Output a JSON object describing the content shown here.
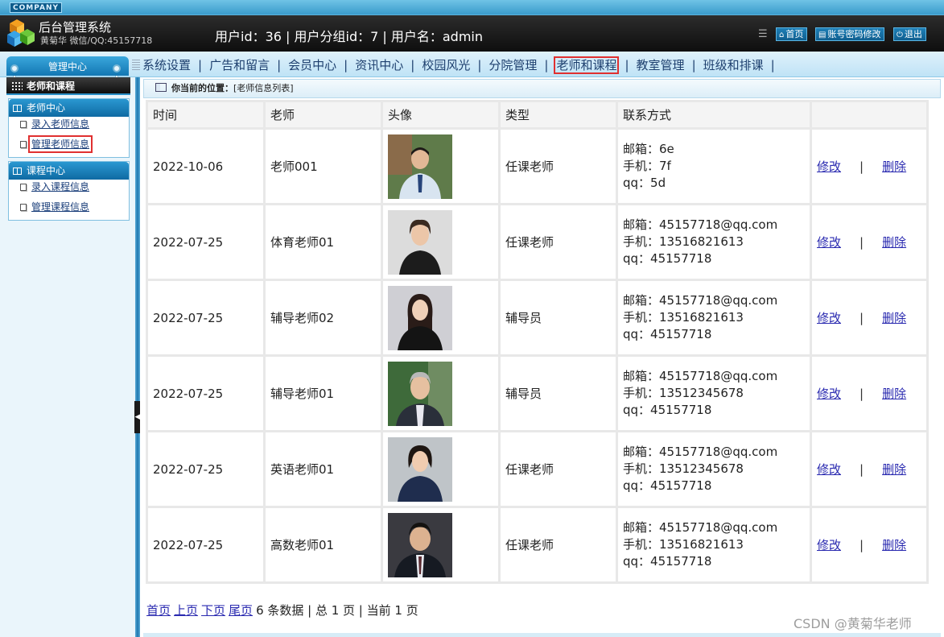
{
  "header": {
    "company": "COMPANY",
    "title": "后台管理系统",
    "author": "黄菊华 微信/QQ:45157718",
    "user_info": "用户id：36 | 用户分组id：7 | 用户名：admin",
    "buttons": {
      "home": "首页",
      "password": "账号密码修改",
      "logout": "退出"
    }
  },
  "nav": {
    "management_center": "管理中心",
    "items": [
      "系统设置",
      "广告和留言",
      "会员中心",
      "资讯中心",
      "校园风光",
      "分院管理",
      "老师和课程",
      "教室管理",
      "班级和排课"
    ],
    "active": "老师和课程",
    "separator": "|"
  },
  "sidebar": {
    "heading": "老师和课程",
    "groups": [
      {
        "title": "老师中心",
        "items": [
          "录入老师信息",
          "管理老师信息"
        ]
      },
      {
        "title": "课程中心",
        "items": [
          "录入课程信息",
          "管理课程信息"
        ]
      }
    ],
    "active_item": "管理老师信息"
  },
  "breadcrumb": {
    "label": "你当前的位置：",
    "value": "[老师信息列表]"
  },
  "table": {
    "headers": [
      "时间",
      "老师",
      "头像",
      "类型",
      "联系方式",
      ""
    ],
    "rows": [
      {
        "time": "2022-10-06",
        "teacher": "老师001",
        "type": "任课老师",
        "email": "邮箱：6e",
        "phone": "手机：7f",
        "qq": "qq：5d",
        "edit": "修改",
        "delete": "删除"
      },
      {
        "time": "2022-07-25",
        "teacher": "体育老师01",
        "type": "任课老师",
        "email": "邮箱：45157718@qq.com",
        "phone": "手机：13516821613",
        "qq": "qq：45157718",
        "edit": "修改",
        "delete": "删除"
      },
      {
        "time": "2022-07-25",
        "teacher": "辅导老师02",
        "type": "辅导员",
        "email": "邮箱：45157718@qq.com",
        "phone": "手机：13516821613",
        "qq": "qq：45157718",
        "edit": "修改",
        "delete": "删除"
      },
      {
        "time": "2022-07-25",
        "teacher": "辅导老师01",
        "type": "辅导员",
        "email": "邮箱：45157718@qq.com",
        "phone": "手机：13512345678",
        "qq": "qq：45157718",
        "edit": "修改",
        "delete": "删除"
      },
      {
        "time": "2022-07-25",
        "teacher": "英语老师01",
        "type": "任课老师",
        "email": "邮箱：45157718@qq.com",
        "phone": "手机：13512345678",
        "qq": "qq：45157718",
        "edit": "修改",
        "delete": "删除"
      },
      {
        "time": "2022-07-25",
        "teacher": "高数老师01",
        "type": "任课老师",
        "email": "邮箱：45157718@qq.com",
        "phone": "手机：13516821613",
        "qq": "qq：45157718",
        "edit": "修改",
        "delete": "删除"
      }
    ]
  },
  "pager": {
    "first": "首页",
    "prev": "上页",
    "next": "下页",
    "last": "尾页",
    "summary": "6 条数据 | 总 1 页 | 当前 1 页"
  },
  "watermark": "CSDN @黄菊华老师",
  "colors": {
    "accent": "#1577b2",
    "highlight_border": "#e03030",
    "link": "#2a2ab0"
  }
}
